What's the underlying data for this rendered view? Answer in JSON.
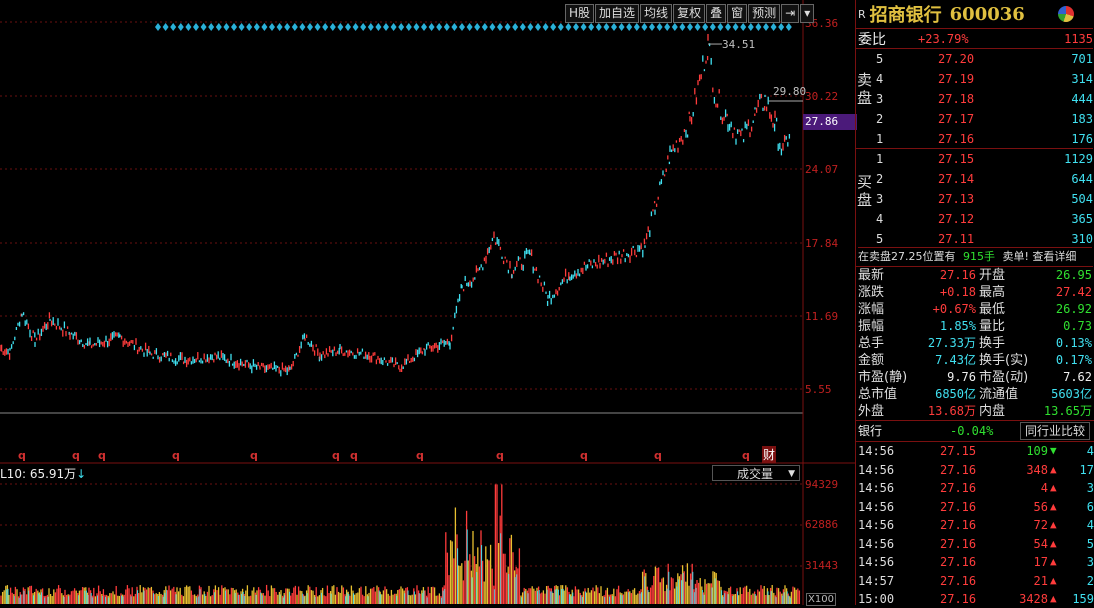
{
  "toolbar": {
    "items": [
      "H股",
      "加自选",
      "均线",
      "复权",
      "叠",
      "窗",
      "预测"
    ]
  },
  "price_axis": [
    "36.36",
    "30.22",
    "24.07",
    "17.84",
    "11.69",
    "5.55"
  ],
  "current_price_tag": "27.86",
  "high_label": "34.51",
  "right_label": "29.80",
  "q_marker": "q",
  "cai_marker": "财",
  "volume": {
    "indicator_text": "L10: 65.91万",
    "indicator_arrow": "↓",
    "select_label": "成交量",
    "axis": [
      "94329",
      "62886",
      "31443"
    ],
    "unit": "X100"
  },
  "stock": {
    "r_label": "R",
    "name": "招商银行",
    "code": "600036"
  },
  "weibi": {
    "label": "委比",
    "value": "+23.79%",
    "diff": "1135"
  },
  "sell_side_label": "卖盘",
  "buy_side_label": "买盘",
  "sell": [
    {
      "level": "5",
      "price": "27.20",
      "vol": "701"
    },
    {
      "level": "4",
      "price": "27.19",
      "vol": "314"
    },
    {
      "level": "3",
      "price": "27.18",
      "vol": "444"
    },
    {
      "level": "2",
      "price": "27.17",
      "vol": "183"
    },
    {
      "level": "1",
      "price": "27.16",
      "vol": "176"
    }
  ],
  "buy": [
    {
      "level": "1",
      "price": "27.15",
      "vol": "1129"
    },
    {
      "level": "2",
      "price": "27.14",
      "vol": "644"
    },
    {
      "level": "3",
      "price": "27.13",
      "vol": "504"
    },
    {
      "level": "4",
      "price": "27.12",
      "vol": "365"
    },
    {
      "level": "5",
      "price": "27.11",
      "vol": "310"
    }
  ],
  "notice": {
    "text1": "在卖盘27.25位置有",
    "vol": "915手",
    "text2": "卖单! 查看详细"
  },
  "quotes": [
    {
      "l1": "最新",
      "v1": "27.16",
      "c1": "red",
      "l2": "开盘",
      "v2": "26.95",
      "c2": "green"
    },
    {
      "l1": "涨跌",
      "v1": "+0.18",
      "c1": "red",
      "l2": "最高",
      "v2": "27.42",
      "c2": "red"
    },
    {
      "l1": "涨幅",
      "v1": "+0.67%",
      "c1": "red",
      "l2": "最低",
      "v2": "26.92",
      "c2": "green"
    },
    {
      "l1": "振幅",
      "v1": "1.85%",
      "c1": "cyan",
      "l2": "量比",
      "v2": "0.73",
      "c2": "green"
    },
    {
      "l1": "总手",
      "v1": "27.33万",
      "c1": "cyan",
      "l2": "换手",
      "v2": "0.13%",
      "c2": "cyan"
    },
    {
      "l1": "金额",
      "v1": "7.43亿",
      "c1": "cyan",
      "l2": "换手(实)",
      "v2": "0.17%",
      "c2": "cyan"
    },
    {
      "l1": "市盈(静)",
      "v1": "9.76",
      "c1": "white",
      "l2": "市盈(动)",
      "v2": "7.62",
      "c2": "white"
    },
    {
      "l1": "总市值",
      "v1": "6850亿",
      "c1": "cyan",
      "l2": "流通值",
      "v2": "5603亿",
      "c2": "cyan"
    },
    {
      "l1": "外盘",
      "v1": "13.68万",
      "c1": "red",
      "l2": "内盘",
      "v2": "13.65万",
      "c2": "green"
    }
  ],
  "industry": {
    "label": "银行",
    "change": "-0.04%",
    "button": "同行业比较"
  },
  "ticks": [
    {
      "time": "14:56",
      "price": "27.15",
      "vol": "109",
      "dir": "down",
      "n": "4"
    },
    {
      "time": "14:56",
      "price": "27.16",
      "vol": "348",
      "dir": "up",
      "n": "17"
    },
    {
      "time": "14:56",
      "price": "27.16",
      "vol": "4",
      "dir": "up",
      "n": "3"
    },
    {
      "time": "14:56",
      "price": "27.16",
      "vol": "56",
      "dir": "up",
      "n": "6"
    },
    {
      "time": "14:56",
      "price": "27.16",
      "vol": "72",
      "dir": "up",
      "n": "4"
    },
    {
      "time": "14:56",
      "price": "27.16",
      "vol": "54",
      "dir": "up",
      "n": "5"
    },
    {
      "time": "14:56",
      "price": "27.16",
      "vol": "17",
      "dir": "up",
      "n": "3"
    },
    {
      "time": "14:57",
      "price": "27.16",
      "vol": "21",
      "dir": "up",
      "n": "2"
    },
    {
      "time": "15:00",
      "price": "27.16",
      "vol": "3428",
      "dir": "up",
      "n": "159"
    }
  ],
  "colors": {
    "up": "#ff3c3c",
    "down": "#30e030",
    "line": "#40e0f0",
    "grid": "#6a1010",
    "diamond": "#2ab0d8",
    "label_highlight": "#4b1a7a"
  }
}
